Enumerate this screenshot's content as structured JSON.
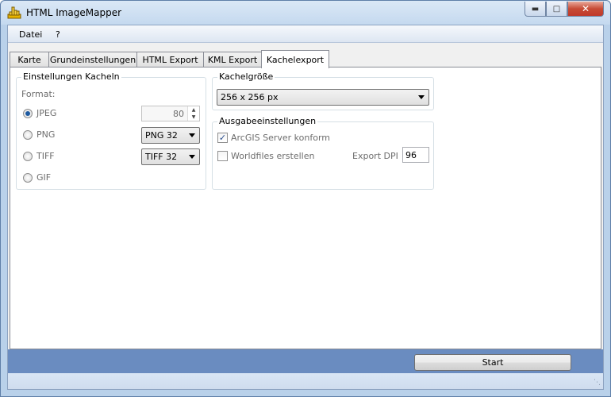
{
  "window": {
    "title": "HTML ImageMapper"
  },
  "menu": {
    "items": [
      "Datei",
      "?"
    ]
  },
  "tabs": [
    {
      "label": "Karte",
      "active": false
    },
    {
      "label": "Grundeinstellungen",
      "active": false
    },
    {
      "label": "HTML Export",
      "active": false
    },
    {
      "label": "KML Export",
      "active": false
    },
    {
      "label": "Kachelexport",
      "active": true
    }
  ],
  "tiles_group": {
    "title": "Einstellungen Kacheln",
    "format_label": "Format:",
    "formats": [
      {
        "label": "JPEG",
        "checked": true
      },
      {
        "label": "PNG",
        "checked": false
      },
      {
        "label": "TIFF",
        "checked": false
      },
      {
        "label": "GIF",
        "checked": false
      }
    ],
    "jpeg_quality": "80",
    "png_depth": "PNG 32",
    "tiff_depth": "TIFF 32"
  },
  "size_group": {
    "title": "Kachelgröße",
    "value": "256 x 256 px"
  },
  "output_group": {
    "title": "Ausgabeeinstellungen",
    "arcgis_label": "ArcGIS Server konform",
    "arcgis_checked": true,
    "worldfiles_label": "Worldfiles erstellen",
    "worldfiles_checked": false,
    "dpi_label": "Export DPI",
    "dpi_value": "96"
  },
  "actions": {
    "start_label": "Start"
  },
  "colors": {
    "bottom_bar": "#6a8cc0",
    "accent": "#1e395b"
  }
}
